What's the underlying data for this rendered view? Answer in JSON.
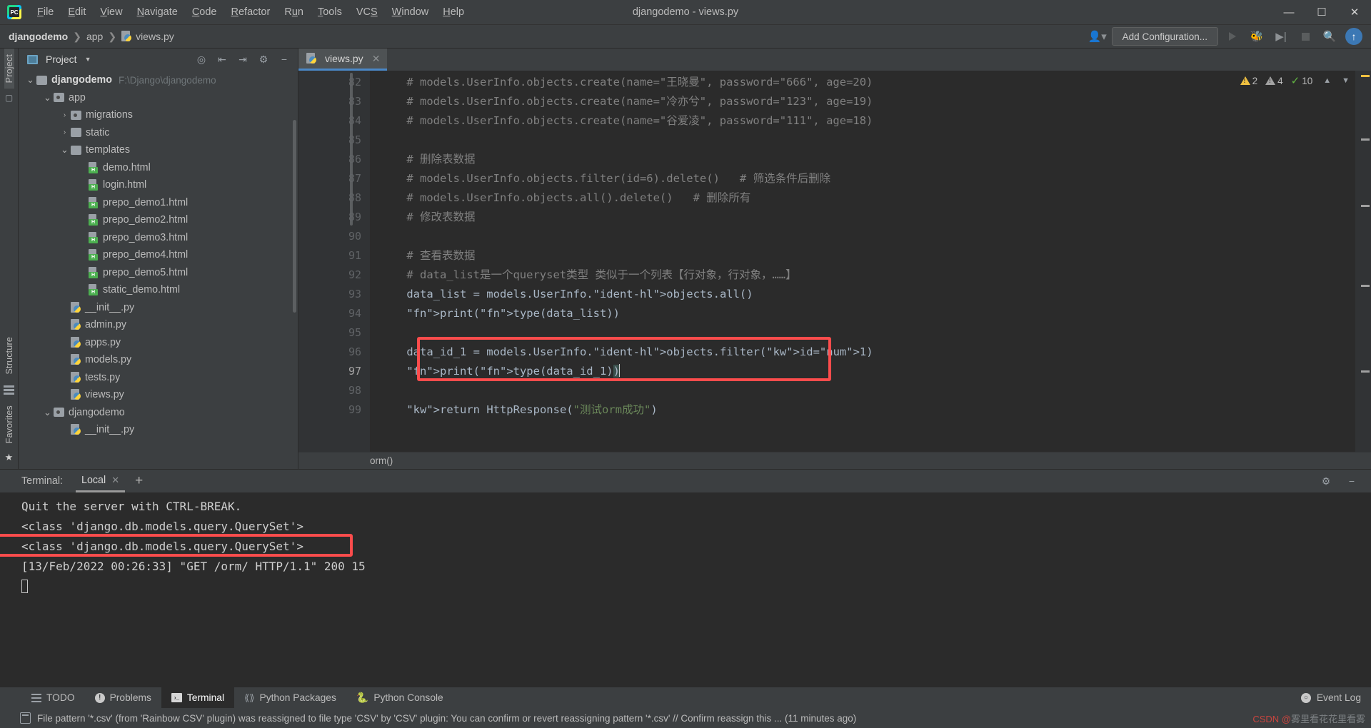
{
  "window": {
    "title": "djangodemo - views.py",
    "app_logo": "pycharm-logo",
    "controls": {
      "minimize": "—",
      "maximize": "❐",
      "close": "✕"
    }
  },
  "menu": [
    {
      "label": "File"
    },
    {
      "label": "Edit"
    },
    {
      "label": "View"
    },
    {
      "label": "Navigate"
    },
    {
      "label": "Code"
    },
    {
      "label": "Refactor"
    },
    {
      "label": "Run"
    },
    {
      "label": "Tools"
    },
    {
      "label": "VCS"
    },
    {
      "label": "Window"
    },
    {
      "label": "Help"
    }
  ],
  "navbar": {
    "breadcrumbs": [
      {
        "label": "djangodemo",
        "icon": "",
        "bold": true
      },
      {
        "label": "app",
        "icon": ""
      },
      {
        "label": "views.py",
        "icon": "python-file-icon"
      }
    ],
    "add_configuration": "Add Configuration...",
    "icons": [
      "user-settings-icon",
      "run-icon",
      "debug-icon",
      "coverage-icon",
      "stop-icon",
      "search-icon",
      "updates-icon"
    ]
  },
  "left_rail": {
    "top_label": "Project",
    "bottom_labels": [
      "Structure",
      "Favorites"
    ]
  },
  "project_pane": {
    "title": "Project",
    "actions": [
      "locate-icon",
      "expand-all-icon",
      "collapse-all-icon",
      "settings-icon",
      "hide-icon"
    ],
    "tree": [
      {
        "depth": 0,
        "twist": "⌄",
        "icon": "folder",
        "label": "djangodemo",
        "bold": true,
        "path": "F:\\Django\\djangodemo"
      },
      {
        "depth": 1,
        "twist": "⌄",
        "icon": "folder-src",
        "label": "app"
      },
      {
        "depth": 2,
        "twist": "›",
        "icon": "folder-src",
        "label": "migrations"
      },
      {
        "depth": 2,
        "twist": "›",
        "icon": "folder",
        "label": "static"
      },
      {
        "depth": 2,
        "twist": "⌄",
        "icon": "folder",
        "label": "templates"
      },
      {
        "depth": 3,
        "twist": "",
        "icon": "html",
        "label": "demo.html"
      },
      {
        "depth": 3,
        "twist": "",
        "icon": "html",
        "label": "login.html"
      },
      {
        "depth": 3,
        "twist": "",
        "icon": "html",
        "label": "prepo_demo1.html"
      },
      {
        "depth": 3,
        "twist": "",
        "icon": "html",
        "label": "prepo_demo2.html"
      },
      {
        "depth": 3,
        "twist": "",
        "icon": "html",
        "label": "prepo_demo3.html"
      },
      {
        "depth": 3,
        "twist": "",
        "icon": "html",
        "label": "prepo_demo4.html"
      },
      {
        "depth": 3,
        "twist": "",
        "icon": "html",
        "label": "prepo_demo5.html"
      },
      {
        "depth": 3,
        "twist": "",
        "icon": "html",
        "label": "static_demo.html"
      },
      {
        "depth": 2,
        "twist": "",
        "icon": "python",
        "label": "__init__.py"
      },
      {
        "depth": 2,
        "twist": "",
        "icon": "python",
        "label": "admin.py"
      },
      {
        "depth": 2,
        "twist": "",
        "icon": "python",
        "label": "apps.py"
      },
      {
        "depth": 2,
        "twist": "",
        "icon": "python",
        "label": "models.py"
      },
      {
        "depth": 2,
        "twist": "",
        "icon": "python",
        "label": "tests.py"
      },
      {
        "depth": 2,
        "twist": "",
        "icon": "python",
        "label": "views.py"
      },
      {
        "depth": 1,
        "twist": "⌄",
        "icon": "folder-src",
        "label": "djangodemo"
      },
      {
        "depth": 2,
        "twist": "",
        "icon": "python",
        "label": "__init__.py"
      }
    ]
  },
  "editor": {
    "tabs": [
      {
        "label": "views.py",
        "icon": "python-file-icon",
        "active": true
      }
    ],
    "inspection": {
      "warnings": "2",
      "weak_warnings": "4",
      "typos": "10"
    },
    "first_line_number": 82,
    "lines": [
      {
        "n": 82,
        "text": "    # models.UserInfo.objects.create(name=\"王晓曼\", password=\"666\", age=20)",
        "kind": "comment"
      },
      {
        "n": 83,
        "text": "    # models.UserInfo.objects.create(name=\"冷亦兮\", password=\"123\", age=19)",
        "kind": "comment"
      },
      {
        "n": 84,
        "text": "    # models.UserInfo.objects.create(name=\"谷爱凌\", password=\"111\", age=18)",
        "kind": "comment"
      },
      {
        "n": 85,
        "text": "",
        "kind": "blank"
      },
      {
        "n": 86,
        "text": "    # 删除表数据",
        "kind": "comment"
      },
      {
        "n": 87,
        "text": "    # models.UserInfo.objects.filter(id=6).delete()   # 筛选条件后删除",
        "kind": "comment"
      },
      {
        "n": 88,
        "text": "    # models.UserInfo.objects.all().delete()   # 删除所有",
        "kind": "comment"
      },
      {
        "n": 89,
        "text": "    # 修改表数据",
        "kind": "comment"
      },
      {
        "n": 90,
        "text": "",
        "kind": "blank"
      },
      {
        "n": 91,
        "text": "    # 查看表数据",
        "kind": "comment"
      },
      {
        "n": 92,
        "text": "    # data_list是一个queryset类型 类似于一个列表【行对象，行对象，……】",
        "kind": "comment",
        "fold": true
      },
      {
        "n": 93,
        "text": "    data_list = models.UserInfo.objects.all()",
        "kind": "code"
      },
      {
        "n": 94,
        "text": "    print(type(data_list))",
        "kind": "code"
      },
      {
        "n": 95,
        "text": "",
        "kind": "blank"
      },
      {
        "n": 96,
        "text": "    data_id_1 = models.UserInfo.objects.filter(id=1)",
        "kind": "code",
        "highlighted": true
      },
      {
        "n": 97,
        "text": "    print(type(data_id_1))",
        "kind": "code",
        "highlighted": true,
        "caret": true
      },
      {
        "n": 98,
        "text": "",
        "kind": "blank"
      },
      {
        "n": 99,
        "text": "    return HttpResponse(\"测试orm成功\")",
        "kind": "code",
        "fold": true
      }
    ],
    "breadcrumb_bottom": "orm()"
  },
  "terminal": {
    "label": "Terminal:",
    "tab": "Local",
    "add_button": "+",
    "actions": [
      "settings-icon",
      "hide-icon"
    ],
    "lines": [
      {
        "text": "Quit the server with CTRL-BREAK.",
        "highlighted": false
      },
      {
        "text": "<class 'django.db.models.query.QuerySet'>",
        "highlighted": false
      },
      {
        "text": "<class 'django.db.models.query.QuerySet'>",
        "highlighted": true
      },
      {
        "text": "[13/Feb/2022 00:26:33] \"GET /orm/ HTTP/1.1\" 200 15",
        "highlighted": false
      }
    ]
  },
  "bottom_tabs": [
    {
      "label": "TODO",
      "icon": "todo-icon",
      "active": false
    },
    {
      "label": "Problems",
      "icon": "problems-icon",
      "active": false
    },
    {
      "label": "Terminal",
      "icon": "terminal-icon",
      "active": true
    },
    {
      "label": "Python Packages",
      "icon": "packages-icon",
      "active": false
    },
    {
      "label": "Python Console",
      "icon": "python-console-icon",
      "active": false
    }
  ],
  "bottom_right": {
    "label": "Event Log",
    "icon": "event-log-icon"
  },
  "statusbar": {
    "message": "File pattern '*.csv' (from 'Rainbow CSV' plugin) was reassigned to file type 'CSV' by 'CSV' plugin: You can confirm or revert reassigning pattern '*.csv' // Confirm reassign this ... (11 minutes ago)",
    "watermark_prefix": "CSDN @",
    "watermark_name": "雾里看花花里看雾"
  },
  "colors": {
    "accent": "#4a88c7",
    "highlight_box": "#fc4c4c",
    "comment": "#808080",
    "keyword": "#cc7832",
    "string": "#6a8759",
    "number": "#6897bb",
    "function": "#8888c6",
    "background": "#2b2b2b",
    "chrome": "#3c3f41"
  }
}
